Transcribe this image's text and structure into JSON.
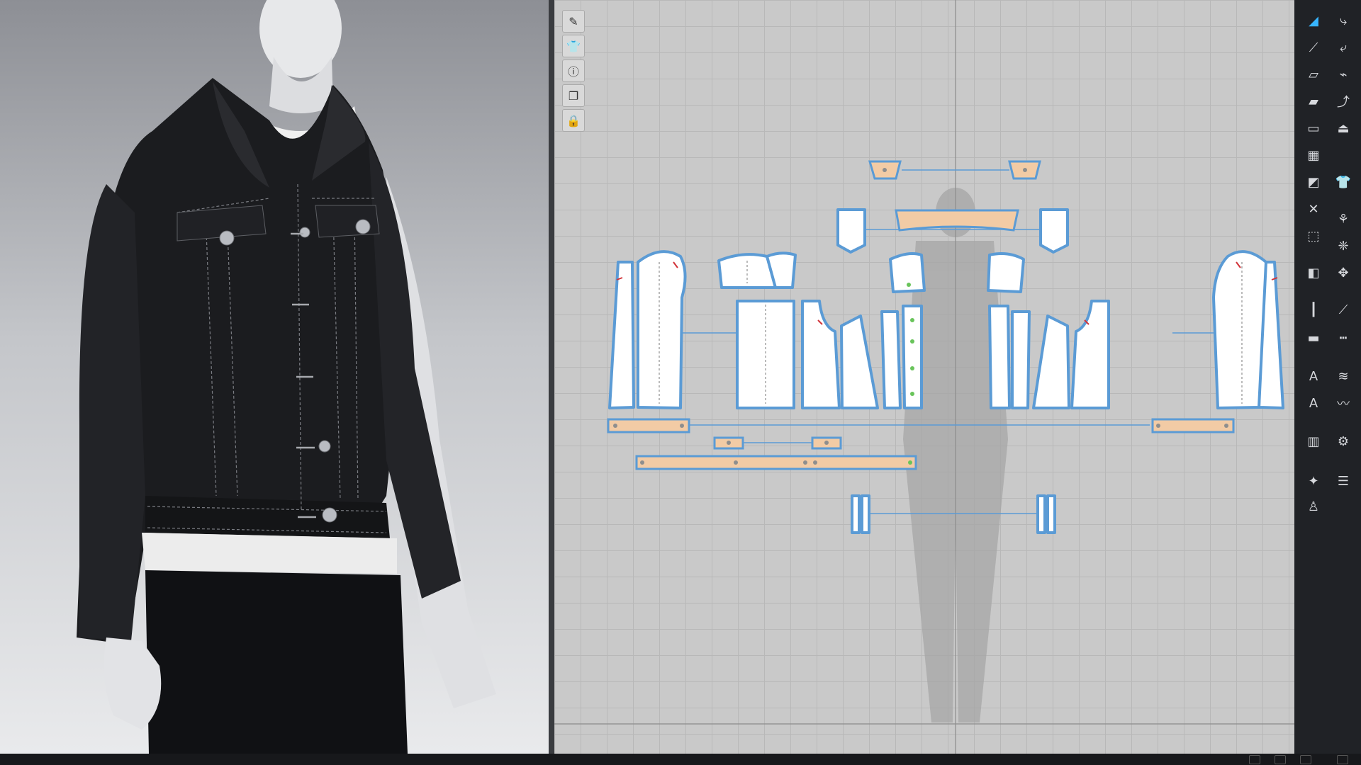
{
  "viewport_3d": {
    "garment": "denim-jacket",
    "fabric_color": "#1c1d20",
    "avatar_color": "#e6e6e8"
  },
  "pattern_window": {
    "background": "#c9c9c9",
    "piece_fill": "#ffffff",
    "trim_fill": "#f2cba5",
    "outline_color": "#5b9bd5"
  },
  "tools_2d": [
    {
      "icon": "brush-icon"
    },
    {
      "icon": "shirt-icon"
    },
    {
      "icon": "info-icon"
    },
    {
      "icon": "layers-icon"
    },
    {
      "icon": "lock-shirt-icon"
    }
  ],
  "right_toolbar": [
    {
      "icon": "transform-pattern-icon",
      "active": true
    },
    {
      "icon": "avatar-sync-icon"
    },
    {
      "icon": "edit-point-icon"
    },
    {
      "icon": "edit-curve-icon"
    },
    {
      "icon": "rectangle-icon"
    },
    {
      "icon": "internal-polygon-icon"
    },
    {
      "icon": "polygon-icon"
    },
    {
      "icon": "sewing-icon"
    },
    {
      "icon": "trace-icon"
    },
    {
      "icon": "iron-icon"
    },
    {
      "icon": "texture-icon"
    },
    {
      "icon": "fold-icon"
    },
    {
      "icon": "cut-icon"
    },
    {
      "icon": "tuck-icon"
    },
    {
      "icon": "dart-icon"
    },
    {
      "icon": "pin-icon"
    },
    {
      "icon": "segment-sewing-icon"
    },
    {
      "icon": "measure-icon"
    },
    {
      "icon": "ruler-icon"
    },
    {
      "icon": "dash-icon"
    },
    {
      "icon": "annotation-icon"
    },
    {
      "icon": "zigzag-icon"
    },
    {
      "icon": "text-icon"
    },
    {
      "icon": "grade-icon"
    },
    {
      "icon": "grid-icon"
    },
    {
      "icon": "fabric-icon"
    },
    {
      "icon": "gift-icon"
    },
    {
      "icon": "puzzle-icon"
    },
    {
      "icon": "avatar-pose-icon"
    }
  ]
}
